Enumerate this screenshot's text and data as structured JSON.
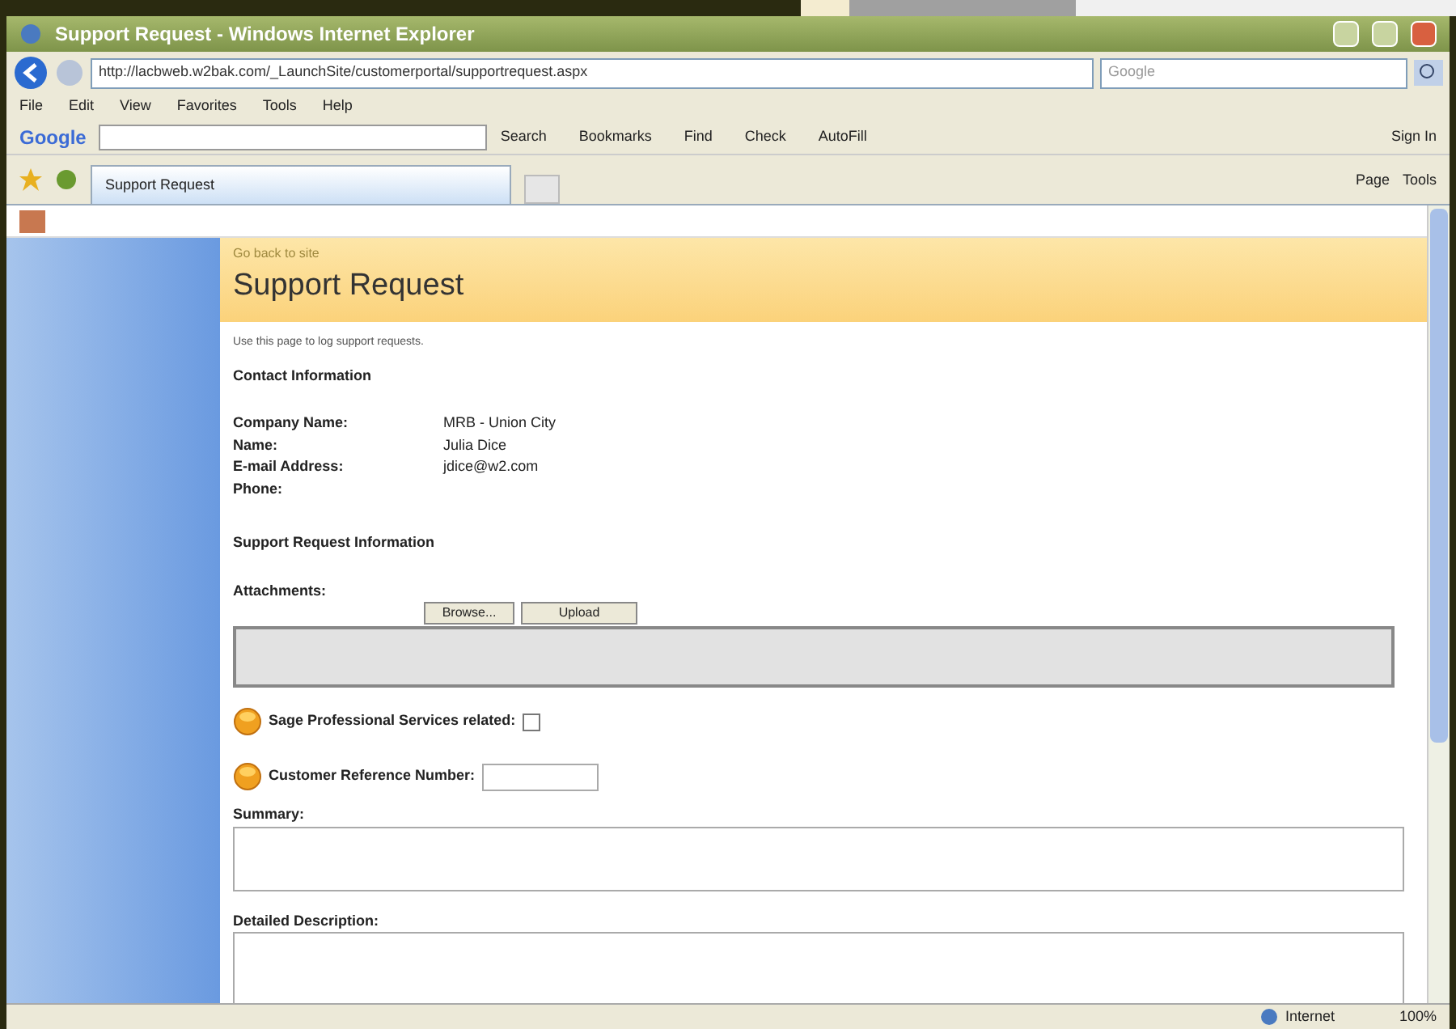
{
  "window": {
    "title": "Support Request - Windows Internet Explorer"
  },
  "address_bar": {
    "url": "http://lacbweb.w2bak.com/_LaunchSite/customerportal/supportrequest.aspx",
    "search_placeholder": "Google"
  },
  "menu": [
    "File",
    "Edit",
    "View",
    "Favorites",
    "Tools",
    "Help"
  ],
  "google_toolbar": {
    "logo": "Google",
    "items": [
      "Search",
      "Bookmarks",
      "Find",
      "Check",
      "AutoFill"
    ],
    "sign_in": "Sign In"
  },
  "tabs": [
    {
      "label": "Support Request",
      "selected": true
    }
  ],
  "command_bar": [
    "Page",
    "Tools"
  ],
  "page": {
    "back_link": "Go back to site",
    "title": "Support Request",
    "intro": "Use this page to log support requests.",
    "contact_heading": "Contact Information",
    "contact_fields": [
      {
        "label": "Company Name:",
        "value": "MRB - Union City"
      },
      {
        "label": "Name:",
        "value": "Julia Dice"
      },
      {
        "label": "E-mail Address:",
        "value": "jdice@w2.com"
      },
      {
        "label": "Phone:"
      }
    ],
    "request_heading": "Support Request Information",
    "attachments_label": "Attachments:",
    "browse_button": "Browse...",
    "upload_button": "Upload",
    "professional_services": {
      "label": "Sage Professional Services related:",
      "checked": false
    },
    "reference_label": "Customer Reference Number:",
    "summary_label": "Summary:",
    "description_label": "Detailed Description:"
  },
  "status_bar": {
    "zone": "Internet",
    "zoom": "100%"
  }
}
